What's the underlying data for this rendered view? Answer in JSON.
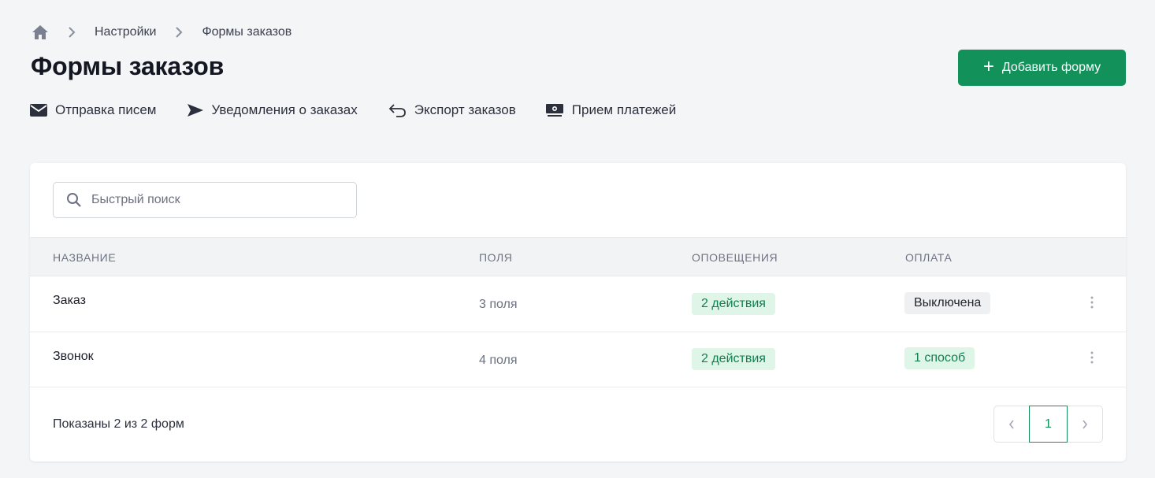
{
  "breadcrumb": {
    "home_icon": "home-icon",
    "items": [
      "Настройки",
      "Формы заказов"
    ]
  },
  "page": {
    "title": "Формы заказов",
    "add_button_label": "Добавить форму"
  },
  "actions": [
    {
      "label": "Отправка писем",
      "icon": "envelope-icon"
    },
    {
      "label": "Уведомления о заказах",
      "icon": "send-icon"
    },
    {
      "label": "Экспорт заказов",
      "icon": "export-arrow-icon"
    },
    {
      "label": "Прием платежей",
      "icon": "money-icon"
    }
  ],
  "search": {
    "placeholder": "Быстрый поиск"
  },
  "table": {
    "columns": [
      "НАЗВАНИЕ",
      "ПОЛЯ",
      "ОПОВЕЩЕНИЯ",
      "ОПЛАТА"
    ],
    "rows": [
      {
        "name": "Заказ",
        "fields": "3 поля",
        "notifications": "2 действия",
        "payment": "Выключена",
        "payment_enabled": false
      },
      {
        "name": "Звонок",
        "fields": "4 поля",
        "notifications": "2 действия",
        "payment": "1 способ",
        "payment_enabled": true
      }
    ]
  },
  "footer": {
    "summary": "Показаны 2 из 2 форм",
    "current_page": "1"
  },
  "colors": {
    "primary": "#12915a",
    "badge_green_bg": "#dff5e8",
    "badge_green_text": "#11804f",
    "badge_gray_bg": "#eef0f2",
    "background": "#f4f5f7"
  }
}
